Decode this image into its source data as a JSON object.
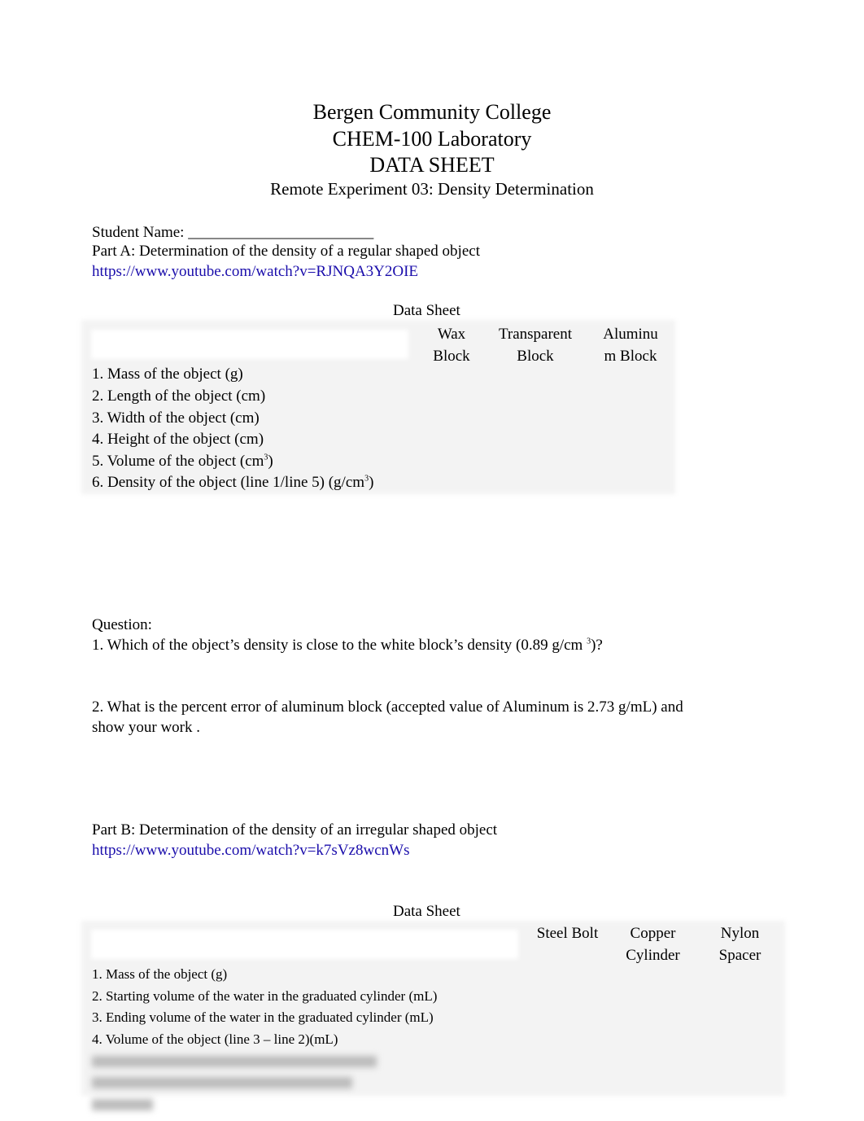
{
  "header": {
    "college": "Bergen Community College",
    "course": "CHEM-100 Laboratory",
    "sheet": "DATA SHEET",
    "experiment": "Remote Experiment 03: Density Determination"
  },
  "student_name": "Student Name: ________________________",
  "part_a": {
    "title": "Part A: Determination of the density of a regular shaped object",
    "link": "https://www.youtube.com/watch?v=RJNQA3Y2OIE",
    "table_title": "Data Sheet",
    "columns": [
      [
        "Wax",
        "Block"
      ],
      [
        "Transparent",
        "Block"
      ],
      [
        "Aluminu",
        "m Block"
      ]
    ],
    "rows": [
      "1. Mass of the object (g)",
      "2. Length of the object (cm)",
      "3. Width of the object (cm)",
      "4. Height of the object (cm)",
      "5. Volume of the object (cm",
      "6. Density of the object (line 1/line 5) (g/cm"
    ],
    "sup": "3"
  },
  "questions": {
    "label": "Question:",
    "q1": "1. Which of the object’s density is close to the white block’s density (0.89 g/cm ",
    "q1_end": ")?",
    "q2a": "2. What is the percent error of aluminum block (accepted value of Aluminum is 2.73 g/mL) and",
    "q2b": "show your work ."
  },
  "part_b": {
    "title": "Part B: Determination of the density of an irregular shaped object",
    "link": "https://www.youtube.com/watch?v=k7sVz8wcnWs",
    "table_title": "Data Sheet",
    "columns": [
      [
        "Steel Bolt",
        ""
      ],
      [
        "Copper",
        "Cylinder"
      ],
      [
        "Nylon",
        "Spacer"
      ]
    ],
    "rows": [
      "1. Mass of the object (g)",
      "2. Starting volume of the water in the graduated cylinder (mL)",
      "3. Ending volume of the water in the graduated cylinder (mL)",
      "4. Volume of the object (line 3 – line 2)(mL)"
    ]
  }
}
